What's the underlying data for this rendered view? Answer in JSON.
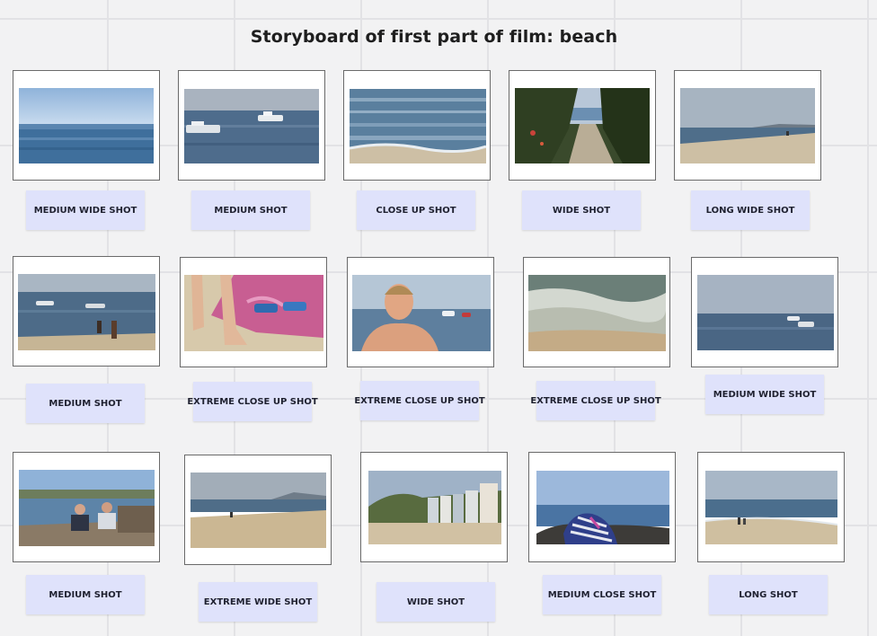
{
  "board": {
    "title": "Storyboard of first part of film: beach"
  },
  "frames": [
    {
      "label": "MEDIUM WIDE SHOT",
      "scene": "open sea, distant horizon"
    },
    {
      "label": "MEDIUM SHOT",
      "scene": "boats on water"
    },
    {
      "label": "CLOSE UP SHOT",
      "scene": "sparkling waves at shore"
    },
    {
      "label": "WIDE SHOT",
      "scene": "path through trees to beach"
    },
    {
      "label": "LONG WIDE SHOT",
      "scene": "long sandy beach"
    },
    {
      "label": "MEDIUM SHOT",
      "scene": "people wading near boats"
    },
    {
      "label": "EXTREME CLOSE UP SHOT",
      "scene": "feet on pink towel"
    },
    {
      "label": "EXTREME CLOSE UP SHOT",
      "scene": "smiling man in water"
    },
    {
      "label": "EXTREME CLOSE UP SHOT",
      "scene": "wave foam on sand"
    },
    {
      "label": "MEDIUM WIDE SHOT",
      "scene": "boats on calm sea"
    },
    {
      "label": "MEDIUM SHOT",
      "scene": "two men sitting on pier"
    },
    {
      "label": "EXTREME WIDE SHOT",
      "scene": "wide beach with hills"
    },
    {
      "label": "WIDE SHOT",
      "scene": "beach huts"
    },
    {
      "label": "MEDIUM CLOSE SHOT",
      "scene": "towel on rocks"
    },
    {
      "label": "LONG SHOT",
      "scene": "figures on beach"
    }
  ]
}
